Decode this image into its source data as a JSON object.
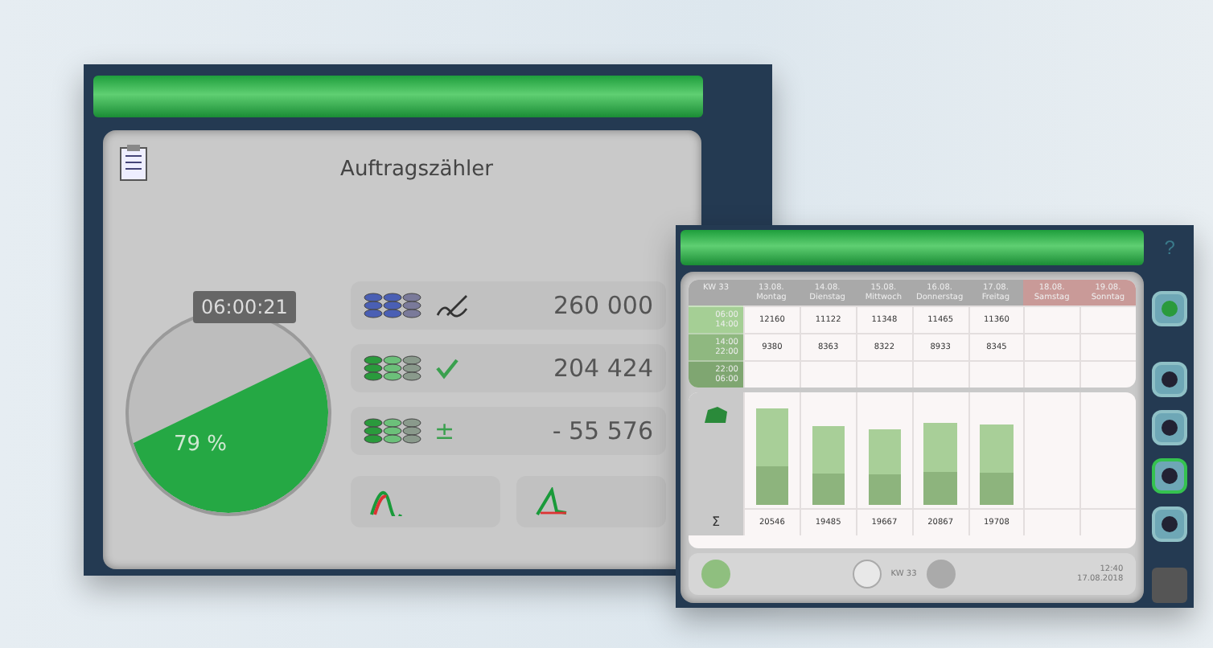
{
  "order_screen": {
    "title": "Auftragszähler",
    "gauge": {
      "timer": "06:00:21",
      "percent": "79 %"
    },
    "counters": [
      {
        "kind": "planned",
        "value": "260 000"
      },
      {
        "kind": "done",
        "value": "204 424"
      },
      {
        "kind": "difference",
        "sign": "±",
        "value": "- 55 576"
      }
    ],
    "curve_buttons": [
      {
        "kind": "bell"
      },
      {
        "kind": "ramp"
      }
    ]
  },
  "week_screen": {
    "help": "?",
    "week": "KW 33",
    "days": [
      {
        "date": "13.08.",
        "name": "Montag",
        "kind": "weekday",
        "sum": "20546",
        "level": 0.93
      },
      {
        "date": "14.08.",
        "name": "Dienstag",
        "kind": "weekday",
        "sum": "19485",
        "level": 0.76
      },
      {
        "date": "15.08.",
        "name": "Mittwoch",
        "kind": "weekday",
        "sum": "19667",
        "level": 0.73
      },
      {
        "date": "16.08.",
        "name": "Donnerstag",
        "kind": "weekday",
        "sum": "20867",
        "level": 0.8
      },
      {
        "date": "17.08.",
        "name": "Freitag",
        "kind": "weekday",
        "sum": "19708",
        "level": 0.77
      },
      {
        "date": "18.08.",
        "name": "Samstag",
        "kind": "weekend"
      },
      {
        "date": "19.08.",
        "name": "Sonntag",
        "kind": "weekend"
      }
    ],
    "shifts": [
      {
        "start": "06:00",
        "end": "14:00",
        "values": [
          "12160",
          "11122",
          "11348",
          "11465",
          "11360"
        ]
      },
      {
        "start": "14:00",
        "end": "22:00",
        "values": [
          "9380",
          "8363",
          "8322",
          "8933",
          "8345"
        ]
      },
      {
        "start": "22:00",
        "end": "06:00"
      }
    ],
    "sum_symbol": "Σ",
    "side_buttons": [
      {
        "selected": false
      },
      {
        "selected": false
      },
      {
        "selected": true
      },
      {
        "selected": false
      }
    ],
    "footer": {
      "week": "KW 33",
      "time": "12:40",
      "date": "17.08.2018"
    }
  }
}
